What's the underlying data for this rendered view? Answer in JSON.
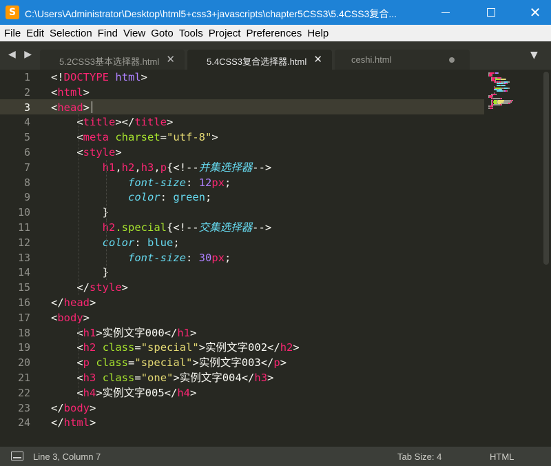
{
  "window": {
    "title": "C:\\Users\\Administrator\\Desktop\\html5+css3+javascripts\\chapter5CSS3\\5.4CSS3复合...",
    "app_icon": "S",
    "minimize_icon": "minimize-icon",
    "maximize_icon": "maximize-icon",
    "close_glyph": "✕"
  },
  "menu": [
    "File",
    "Edit",
    "Selection",
    "Find",
    "View",
    "Goto",
    "Tools",
    "Project",
    "Preferences",
    "Help"
  ],
  "tabs": {
    "nav_arrows": "◀ ▶",
    "items": [
      {
        "label": "5.2CSS3基本选择器.html",
        "close": "✕",
        "active": false
      },
      {
        "label": "5.4CSS3复合选择器.html",
        "close": "✕",
        "active": true
      },
      {
        "label": "ceshi.html",
        "modified": true,
        "active": false
      }
    ],
    "dropdown": "▼"
  },
  "editor": {
    "line_numbers": [
      "1",
      "2",
      "3",
      "4",
      "5",
      "6",
      "7",
      "8",
      "9",
      "10",
      "11",
      "12",
      "13",
      "14",
      "15",
      "16",
      "17",
      "18",
      "19",
      "20",
      "21",
      "22",
      "23",
      "24"
    ],
    "current_line": 3,
    "lines": [
      [
        {
          "t": "<!",
          "c": "pl"
        },
        {
          "t": "DOCTYPE",
          "c": "tag"
        },
        {
          "t": " ",
          "c": "pl"
        },
        {
          "t": "html",
          "c": "doct"
        },
        {
          "t": ">",
          "c": "pl"
        }
      ],
      [
        {
          "t": "<",
          "c": "pl"
        },
        {
          "t": "html",
          "c": "tag"
        },
        {
          "t": ">",
          "c": "pl"
        }
      ],
      [
        {
          "t": "<",
          "c": "pl"
        },
        {
          "t": "head",
          "c": "tag"
        },
        {
          "t": ">",
          "c": "pl"
        }
      ],
      [
        {
          "t": "    <",
          "c": "pl"
        },
        {
          "t": "title",
          "c": "tag"
        },
        {
          "t": "></",
          "c": "pl"
        },
        {
          "t": "title",
          "c": "tag"
        },
        {
          "t": ">",
          "c": "pl"
        }
      ],
      [
        {
          "t": "    <",
          "c": "pl"
        },
        {
          "t": "meta",
          "c": "tag"
        },
        {
          "t": " ",
          "c": "pl"
        },
        {
          "t": "charset",
          "c": "attr"
        },
        {
          "t": "=",
          "c": "pl"
        },
        {
          "t": "\"utf-8\"",
          "c": "str"
        },
        {
          "t": ">",
          "c": "pl"
        }
      ],
      [
        {
          "t": "    <",
          "c": "pl"
        },
        {
          "t": "style",
          "c": "tag"
        },
        {
          "t": ">",
          "c": "pl"
        }
      ],
      [
        {
          "t": "        ",
          "c": "pl"
        },
        {
          "t": "h1",
          "c": "tag"
        },
        {
          "t": ",",
          "c": "pl"
        },
        {
          "t": "h2",
          "c": "tag"
        },
        {
          "t": ",",
          "c": "pl"
        },
        {
          "t": "h3",
          "c": "tag"
        },
        {
          "t": ",",
          "c": "pl"
        },
        {
          "t": "p",
          "c": "tag"
        },
        {
          "t": "{<!--",
          "c": "pl"
        },
        {
          "t": "并集选择器",
          "c": "cmt-text"
        },
        {
          "t": "-->",
          "c": "pl"
        }
      ],
      [
        {
          "t": "            ",
          "c": "pl"
        },
        {
          "t": "font-size",
          "c": "prop"
        },
        {
          "t": ": ",
          "c": "pl"
        },
        {
          "t": "12",
          "c": "num"
        },
        {
          "t": "px",
          "c": "tag"
        },
        {
          "t": ";",
          "c": "pl"
        }
      ],
      [
        {
          "t": "            ",
          "c": "pl"
        },
        {
          "t": "color",
          "c": "prop"
        },
        {
          "t": ": ",
          "c": "pl"
        },
        {
          "t": "green",
          "c": "val"
        },
        {
          "t": ";",
          "c": "pl"
        }
      ],
      [
        {
          "t": "        }",
          "c": "pl"
        }
      ],
      [
        {
          "t": "        ",
          "c": "pl"
        },
        {
          "t": "h2",
          "c": "tag"
        },
        {
          "t": ".special",
          "c": "cls"
        },
        {
          "t": "{<!--",
          "c": "pl"
        },
        {
          "t": "交集选择器",
          "c": "cmt-text"
        },
        {
          "t": "-->",
          "c": "pl"
        }
      ],
      [
        {
          "t": "        ",
          "c": "pl"
        },
        {
          "t": "color",
          "c": "prop"
        },
        {
          "t": ": ",
          "c": "pl"
        },
        {
          "t": "blue",
          "c": "val"
        },
        {
          "t": ";",
          "c": "pl"
        }
      ],
      [
        {
          "t": "            ",
          "c": "pl"
        },
        {
          "t": "font-size",
          "c": "prop"
        },
        {
          "t": ": ",
          "c": "pl"
        },
        {
          "t": "30",
          "c": "num"
        },
        {
          "t": "px",
          "c": "tag"
        },
        {
          "t": ";",
          "c": "pl"
        }
      ],
      [
        {
          "t": "        }",
          "c": "pl"
        }
      ],
      [
        {
          "t": "    </",
          "c": "pl"
        },
        {
          "t": "style",
          "c": "tag"
        },
        {
          "t": ">",
          "c": "pl"
        }
      ],
      [
        {
          "t": "</",
          "c": "pl"
        },
        {
          "t": "head",
          "c": "tag"
        },
        {
          "t": ">",
          "c": "pl"
        }
      ],
      [
        {
          "t": "<",
          "c": "pl"
        },
        {
          "t": "body",
          "c": "tag"
        },
        {
          "t": ">",
          "c": "pl"
        }
      ],
      [
        {
          "t": "    <",
          "c": "pl"
        },
        {
          "t": "h1",
          "c": "tag"
        },
        {
          "t": ">实例文字000</",
          "c": "pl"
        },
        {
          "t": "h1",
          "c": "tag"
        },
        {
          "t": ">",
          "c": "pl"
        }
      ],
      [
        {
          "t": "    <",
          "c": "pl"
        },
        {
          "t": "h2",
          "c": "tag"
        },
        {
          "t": " ",
          "c": "pl"
        },
        {
          "t": "class",
          "c": "attr"
        },
        {
          "t": "=",
          "c": "pl"
        },
        {
          "t": "\"special\"",
          "c": "str"
        },
        {
          "t": ">实例文字002</",
          "c": "pl"
        },
        {
          "t": "h2",
          "c": "tag"
        },
        {
          "t": ">",
          "c": "pl"
        }
      ],
      [
        {
          "t": "    <",
          "c": "pl"
        },
        {
          "t": "p",
          "c": "tag"
        },
        {
          "t": " ",
          "c": "pl"
        },
        {
          "t": "class",
          "c": "attr"
        },
        {
          "t": "=",
          "c": "pl"
        },
        {
          "t": "\"special\"",
          "c": "str"
        },
        {
          "t": ">实例文字003</",
          "c": "pl"
        },
        {
          "t": "p",
          "c": "tag"
        },
        {
          "t": ">",
          "c": "pl"
        }
      ],
      [
        {
          "t": "    <",
          "c": "pl"
        },
        {
          "t": "h3",
          "c": "tag"
        },
        {
          "t": " ",
          "c": "pl"
        },
        {
          "t": "class",
          "c": "attr"
        },
        {
          "t": "=",
          "c": "pl"
        },
        {
          "t": "\"one\"",
          "c": "str"
        },
        {
          "t": ">实例文字004</",
          "c": "pl"
        },
        {
          "t": "h3",
          "c": "tag"
        },
        {
          "t": ">",
          "c": "pl"
        }
      ],
      [
        {
          "t": "    <",
          "c": "pl"
        },
        {
          "t": "h4",
          "c": "tag"
        },
        {
          "t": ">实例文字005</",
          "c": "pl"
        },
        {
          "t": "h4",
          "c": "tag"
        },
        {
          "t": ">",
          "c": "pl"
        }
      ],
      [
        {
          "t": "</",
          "c": "pl"
        },
        {
          "t": "body",
          "c": "tag"
        },
        {
          "t": ">",
          "c": "pl"
        }
      ],
      [
        {
          "t": "</",
          "c": "pl"
        },
        {
          "t": "html",
          "c": "tag"
        },
        {
          "t": ">",
          "c": "pl"
        }
      ]
    ]
  },
  "status": {
    "panel_icon": "panel-icon",
    "position": "Line 3, Column 7",
    "tab_size": "Tab Size: 4",
    "syntax": "HTML"
  },
  "colors": {
    "titlebar": "#1e82d6",
    "editor_bg": "#272822",
    "current_line": "#3e3d32",
    "tag": "#f92672",
    "attr": "#a6e22e",
    "string": "#e6db74",
    "number": "#ae81ff",
    "property": "#66d9ef"
  }
}
